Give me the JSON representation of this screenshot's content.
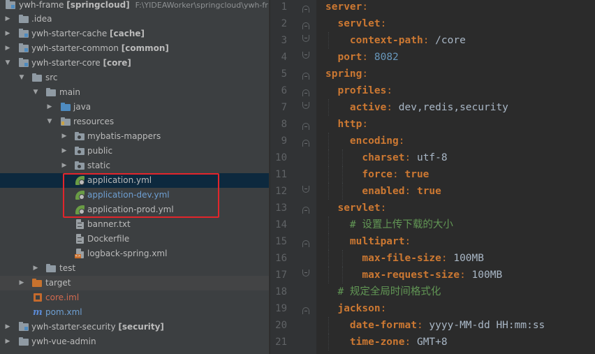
{
  "project_tree": {
    "root": {
      "name": "ywh-frame",
      "module": "[springcloud]",
      "path": "F:\\YIDEAWorker\\springcloud\\ywh-fr"
    },
    "idea": ".idea",
    "cache": {
      "name": "ywh-starter-cache",
      "module": "[cache]"
    },
    "common": {
      "name": "ywh-starter-common",
      "module": "[common]"
    },
    "core": {
      "name": "ywh-starter-core",
      "module": "[core]"
    },
    "src": "src",
    "main": "main",
    "java": "java",
    "resources": "resources",
    "mybatis": "mybatis-mappers",
    "public": "public",
    "static": "static",
    "app_yml": "application.yml",
    "app_dev": "application-dev.yml",
    "app_prod": "application-prod.yml",
    "banner": "banner.txt",
    "docker": "Dockerfile",
    "logback": "logback-spring.xml",
    "test": "test",
    "target": "target",
    "core_iml": "core.iml",
    "pom": "pom.xml",
    "security": {
      "name": "ywh-starter-security",
      "module": "[security]"
    },
    "vue": "ywh-vue-admin"
  },
  "editor": {
    "line_numbers": [
      "1",
      "2",
      "3",
      "4",
      "5",
      "6",
      "7",
      "8",
      "9",
      "10",
      "11",
      "12",
      "13",
      "14",
      "15",
      "16",
      "17",
      "18",
      "19",
      "20",
      "21"
    ],
    "lines": [
      {
        "key": "server",
        "sep": ":",
        "val": ""
      },
      {
        "key": "servlet",
        "sep": ":",
        "val": ""
      },
      {
        "key": "context-path",
        "sep": ":",
        "val": " /core"
      },
      {
        "key": "port",
        "sep": ":",
        "val": " 8082"
      },
      {
        "key": "spring",
        "sep": ":",
        "val": ""
      },
      {
        "key": "profiles",
        "sep": ":",
        "val": ""
      },
      {
        "key": "active",
        "sep": ":",
        "val": " dev,redis,security"
      },
      {
        "key": "http",
        "sep": ":",
        "val": ""
      },
      {
        "key": "encoding",
        "sep": ":",
        "val": ""
      },
      {
        "key": "charset",
        "sep": ":",
        "val": " utf-8"
      },
      {
        "key": "force",
        "sep": ":",
        "val": " true"
      },
      {
        "key": "enabled",
        "sep": ":",
        "val": " true"
      },
      {
        "key": "servlet",
        "sep": ":",
        "val": ""
      },
      {
        "comment": "# 设置上传下载的大小"
      },
      {
        "key": "multipart",
        "sep": ":",
        "val": ""
      },
      {
        "key": "max-file-size",
        "sep": ":",
        "val": " 100MB"
      },
      {
        "key": "max-request-size",
        "sep": ":",
        "val": " 100MB"
      },
      {
        "comment": "# 规定全局时间格式化"
      },
      {
        "key": "jackson",
        "sep": ":",
        "val": ""
      },
      {
        "key": "date-format",
        "sep": ":",
        "val": " yyyy-MM-dd HH:mm:ss"
      },
      {
        "key": "time-zone",
        "sep": ":",
        "val": " GMT+8"
      }
    ]
  },
  "colors": {
    "tree_bg": "#3c3f41",
    "editor_bg": "#2b2b2b",
    "keyword": "#cc7832",
    "number": "#6897bb",
    "comment": "#629755",
    "highlight_box": "#e2252b"
  }
}
